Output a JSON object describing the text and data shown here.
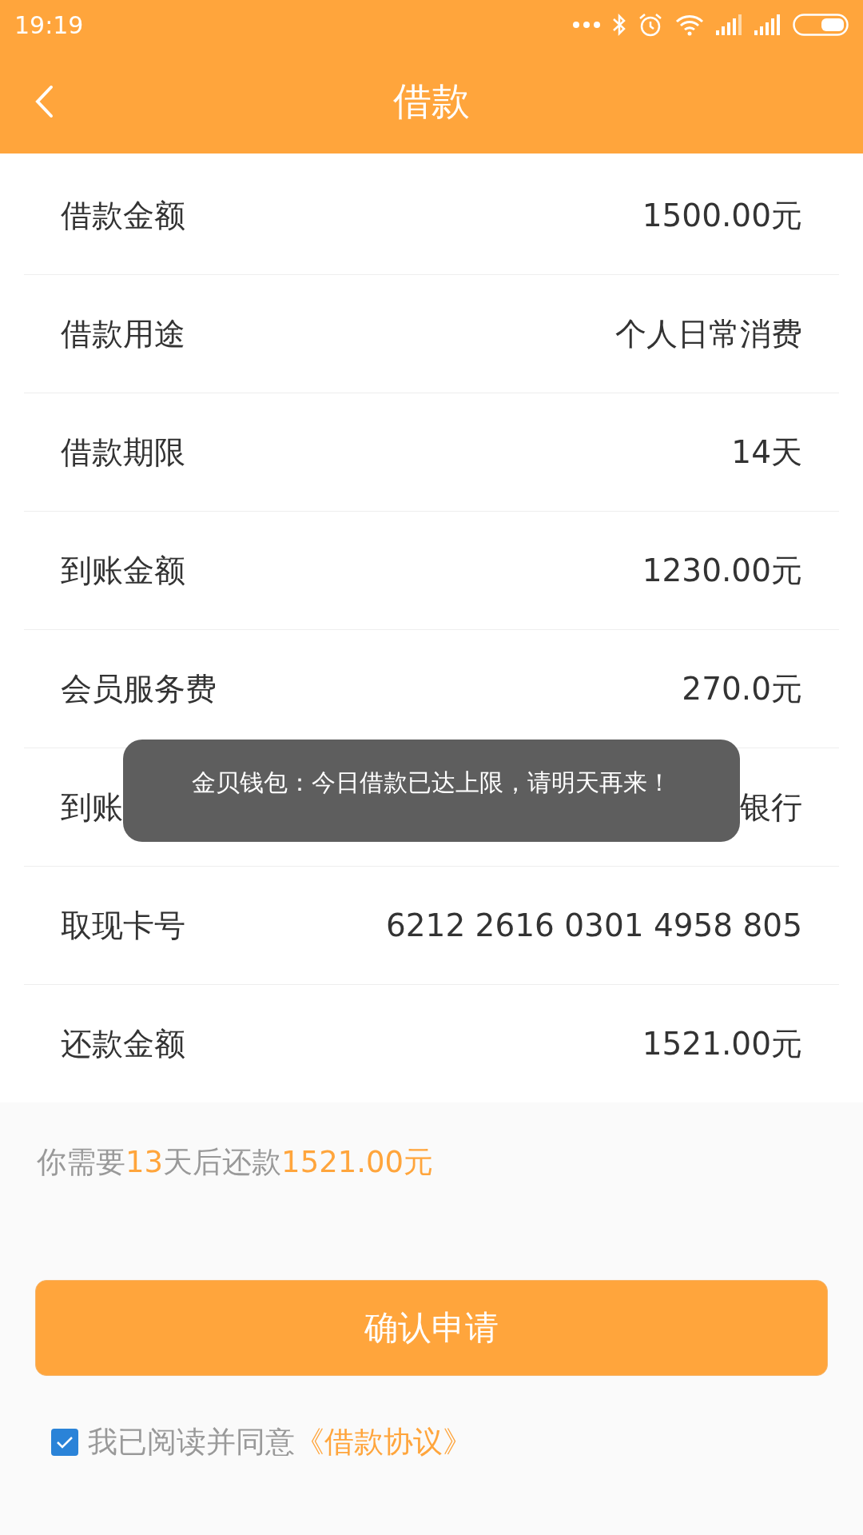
{
  "status_bar": {
    "time": "19:19"
  },
  "header": {
    "title": "借款"
  },
  "rows": [
    {
      "label": "借款金额",
      "value": "1500.00元"
    },
    {
      "label": "借款用途",
      "value": "个人日常消费"
    },
    {
      "label": "借款期限",
      "value": "14天"
    },
    {
      "label": "到账金额",
      "value": "1230.00元"
    },
    {
      "label": "会员服务费",
      "value": "270.0元"
    },
    {
      "label": "到账",
      "value": "银行"
    },
    {
      "label": "取现卡号",
      "value": "6212 2616 0301 4958 805"
    },
    {
      "label": "还款金额",
      "value": "1521.00元"
    }
  ],
  "summary": [
    {
      "kind": "plain",
      "text": "你需要"
    },
    {
      "kind": "highlight",
      "text": "13"
    },
    {
      "kind": "plain",
      "text": "天后还款"
    },
    {
      "kind": "highlight",
      "text": "1521.00元"
    }
  ],
  "confirm_button": "确认申请",
  "agreement": {
    "checked": true,
    "text": "我已阅读并同意",
    "link": "《借款协议》"
  },
  "toast": "金贝钱包：今日借款已达上限，请明天再来！"
}
